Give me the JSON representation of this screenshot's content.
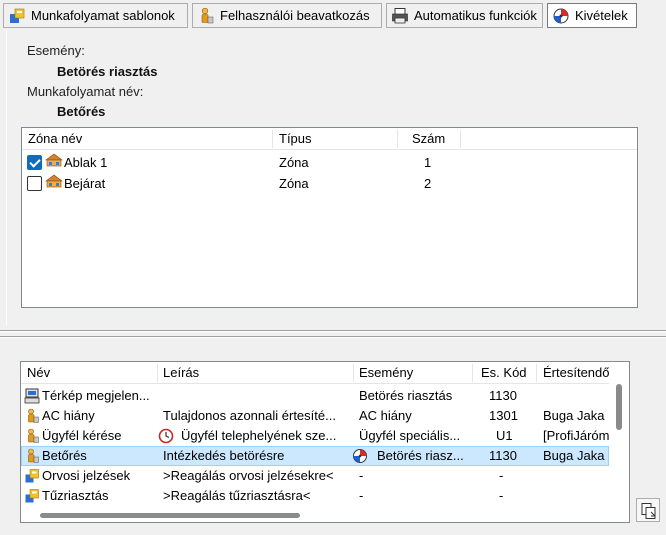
{
  "toolbar": {
    "tabs": [
      {
        "label": "Munkafolyamat sablonok",
        "icon": "workflow-icon"
      },
      {
        "label": "Felhasználói beavatkozás",
        "icon": "user-icon"
      },
      {
        "label": "Automatikus funkciók",
        "icon": "printer-icon"
      },
      {
        "label": "Kivételek",
        "icon": "alarm-icon",
        "active": true
      }
    ]
  },
  "details": {
    "event_label": "Esemény:",
    "event_value": "Betörés riasztás",
    "workflow_label": "Munkafolyamat név:",
    "workflow_value": "Betőrés"
  },
  "zones": {
    "headers": [
      "Zóna név",
      "Típus",
      "Szám"
    ],
    "rows": [
      {
        "name": "Ablak 1",
        "type": "Zóna",
        "num": "1",
        "checked": true
      },
      {
        "name": "Bejárat",
        "type": "Zóna",
        "num": "2",
        "checked": false
      }
    ]
  },
  "list": {
    "headers": [
      "Név",
      "Leírás",
      "Esemény",
      "Es. Kód",
      "Értesítendő"
    ],
    "rows": [
      {
        "name": "Térkép megjelen...",
        "desc": "",
        "event": "Betörés riasztás",
        "code": "1130",
        "notify": "",
        "icon": "computer-icon"
      },
      {
        "name": "AC hiány",
        "desc": "Tulajdonos azonnali értesíté...",
        "event": "AC hiány",
        "code": "1301",
        "notify": "Buga Jaka",
        "icon": "user-icon"
      },
      {
        "name": "Ügyfél kérése",
        "desc": "Ügyfél telephelyének sze...",
        "event": "Ügyfél speciális...",
        "code": "U1",
        "notify": "[ProfiJáróm",
        "icon": "user-icon",
        "desc_icon": "clock-icon"
      },
      {
        "name": "Betőrés",
        "desc": "Intézkedés betörésre",
        "event": "Betörés riasz...",
        "code": "1130",
        "notify": "Buga Jaka",
        "icon": "user-icon",
        "event_icon": "alarm-icon",
        "selected": true
      },
      {
        "name": "Orvosi jelzések",
        "desc": ">Reagálás orvosi jelzésekre<",
        "event": "-",
        "code": "-",
        "notify": "",
        "icon": "workflow-icon"
      },
      {
        "name": "Tűzriasztás",
        "desc": ">Reagálás tűzriasztásra<",
        "event": "-",
        "code": "-",
        "notify": "",
        "icon": "workflow-icon"
      }
    ]
  },
  "colors": {
    "selection": "#cce8ff",
    "checkbox": "#0f6cbd",
    "border": "#828790"
  }
}
